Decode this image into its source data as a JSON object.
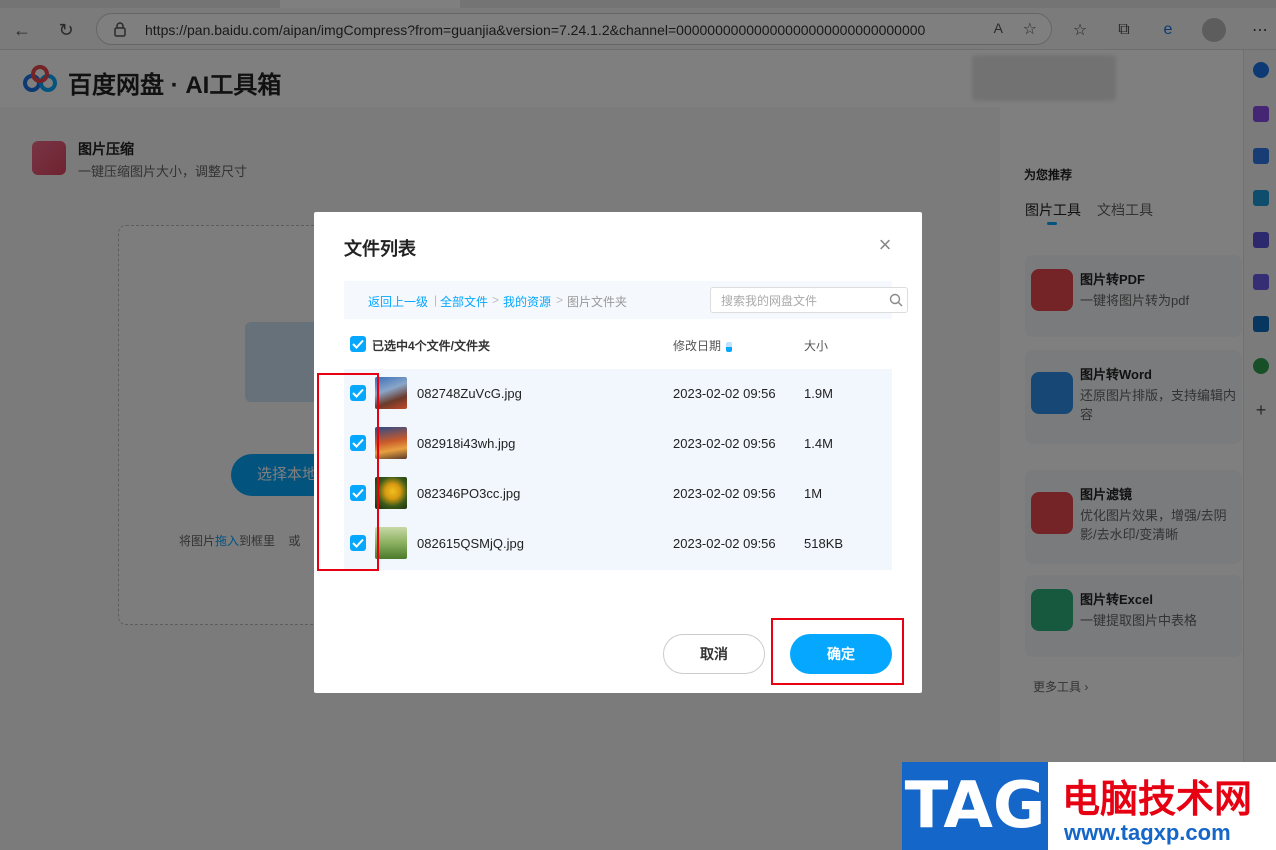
{
  "browser": {
    "url": "https://pan.baidu.com/aipan/imgCompress?from=guanjia&version=7.24.1.2&channel=00000000000000000000000000000000",
    "read_aloud": "A"
  },
  "site": {
    "brand": "百度网盘 · AI工具箱"
  },
  "tool": {
    "title": "图片压缩",
    "desc": "一键压缩图片大小，调整尺寸"
  },
  "dropzone": {
    "button": "选择本地",
    "hint_pre": "将图片",
    "hint_drag": "拖入",
    "hint_post": "到框里",
    "hint_or": "或"
  },
  "recommend": {
    "title": "为您推荐",
    "tabs": [
      "图片工具",
      "文档工具"
    ],
    "cards": [
      {
        "title": "图片转PDF",
        "desc": "一键将图片转为pdf",
        "color": "#e8464f"
      },
      {
        "title": "图片转Word",
        "desc": "还原图片排版，支持编辑内容",
        "color": "#2f8fe8"
      },
      {
        "title": "图片滤镜",
        "desc": "优化图片效果，增强/去阴影/去水印/变清晰",
        "color": "#e8464f"
      },
      {
        "title": "图片转Excel",
        "desc": "一键提取图片中表格",
        "color": "#2fb37e"
      }
    ],
    "more": "更多工具"
  },
  "modal": {
    "title": "文件列表",
    "breadcrumb": {
      "back": "返回上一级",
      "all": "全部文件",
      "my": "我的资源",
      "current": "图片文件夹"
    },
    "search_placeholder": "搜索我的网盘文件",
    "select_summary": "已选中4个文件/文件夹",
    "col_date": "修改日期",
    "col_size": "大小",
    "files": [
      {
        "name": "082748ZuVcG.jpg",
        "date": "2023-02-02 09:56",
        "size": "1.9M"
      },
      {
        "name": "082918i43wh.jpg",
        "date": "2023-02-02 09:56",
        "size": "1.4M"
      },
      {
        "name": "082346PO3cc.jpg",
        "date": "2023-02-02 09:56",
        "size": "1M"
      },
      {
        "name": "082615QSMjQ.jpg",
        "date": "2023-02-02 09:56",
        "size": "518KB"
      }
    ],
    "cancel": "取消",
    "confirm": "确定"
  },
  "watermark": {
    "tag": "TAG",
    "cn": "电脑技术网",
    "url": "www.tagxp.com"
  },
  "colors": {
    "accent": "#06a7ff",
    "highlight": "#e60012"
  }
}
